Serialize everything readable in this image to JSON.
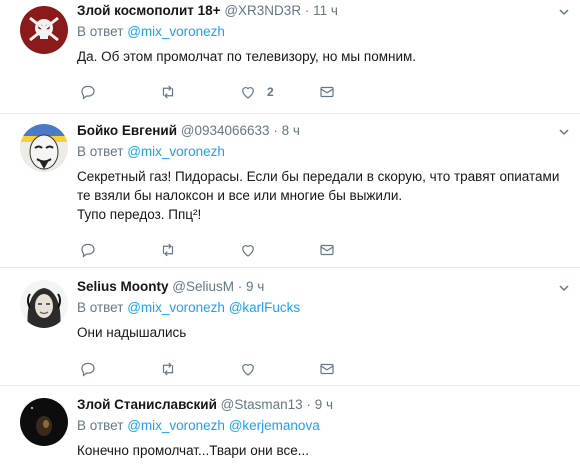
{
  "reply_prefix": "В ответ",
  "tweets": [
    {
      "fullname": "Злой космополит 18+",
      "username": "@XR3ND3R",
      "dot": "·",
      "time": "11 ч",
      "reply_to": [
        "@mix_voronezh"
      ],
      "text": [
        "Да. Об этом промолчат по телевизору, но мы помним."
      ],
      "like_count": "2"
    },
    {
      "fullname": "Бойко Евгений",
      "username": "@0934066633",
      "dot": "·",
      "time": "8 ч",
      "reply_to": [
        "@mix_voronezh"
      ],
      "text": [
        "Секретный газ! Пидорасы. Если бы передали в скорую, что травят опиатами",
        "те взяли бы налоксон и все или многие бы выжили.",
        "Тупо передоз. Ппц²!"
      ],
      "like_count": ""
    },
    {
      "fullname": "Selius Moonty",
      "username": "@SeliusM",
      "dot": "·",
      "time": "9 ч",
      "reply_to": [
        "@mix_voronezh",
        "@karlFucks"
      ],
      "text": [
        "Они надышались"
      ],
      "like_count": ""
    },
    {
      "fullname": "Злой Станиславский",
      "username": "@Stasman13",
      "dot": "·",
      "time": "9 ч",
      "reply_to": [
        "@mix_voronezh",
        "@kerjemanova"
      ],
      "text": [
        "Конечно промолчат...Твари они все..."
      ],
      "like_count": ""
    }
  ],
  "colors": {
    "link": "#1da1f2",
    "secondary": "#657786",
    "border": "#e6ecf0"
  }
}
